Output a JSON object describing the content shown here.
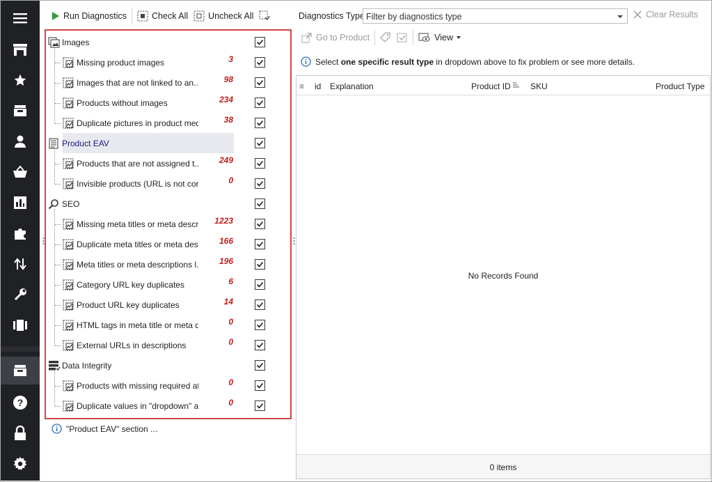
{
  "toolbar": {
    "run_label": "Run Diagnostics",
    "check_all_label": "Check All",
    "uncheck_all_label": "Uncheck All"
  },
  "sidebar": {
    "items": [
      "menu-icon",
      "store-icon",
      "star-icon",
      "inbox-icon",
      "user-icon",
      "basket-icon",
      "chart-icon",
      "puzzle-icon",
      "transfer-icon",
      "wrench-icon",
      "carousel-icon",
      "diagnostics-icon",
      "help-icon",
      "lock-icon",
      "gear-icon"
    ]
  },
  "tree": [
    {
      "type": "group",
      "label": "Images",
      "icon": "images-icon",
      "checked": true
    },
    {
      "type": "item",
      "label": "Missing product images",
      "count": "3",
      "icon": "image-warning-icon",
      "checked": true
    },
    {
      "type": "item",
      "label": "Images that are not linked to an...",
      "count": "98",
      "icon": "image-unlinked-icon",
      "checked": true
    },
    {
      "type": "item",
      "label": "Products without images",
      "count": "234",
      "icon": "image-missing-icon",
      "checked": true
    },
    {
      "type": "item",
      "label": "Duplicate pictures in product med...",
      "count": "38",
      "icon": "image-duplicate-icon",
      "checked": true
    },
    {
      "type": "group",
      "label": "Product  EAV",
      "icon": "eav-icon",
      "checked": true,
      "selected": true
    },
    {
      "type": "item",
      "label": "Products that are not assigned t...",
      "count": "249",
      "icon": "product-unassigned-icon",
      "checked": true
    },
    {
      "type": "item",
      "label": "Invisible products (URL is not cor...",
      "count": "0",
      "icon": "invisible-icon",
      "checked": true
    },
    {
      "type": "group",
      "label": "SEO",
      "icon": "search-icon",
      "checked": true
    },
    {
      "type": "item",
      "label": "Missing meta titles or meta descri...",
      "count": "1223",
      "icon": "meta-missing-icon",
      "checked": true
    },
    {
      "type": "item",
      "label": "Duplicate meta titles or meta des...",
      "count": "166",
      "icon": "meta-duplicate-icon",
      "checked": true
    },
    {
      "type": "item",
      "label": "Meta titles or meta descriptions l...",
      "count": "196",
      "icon": "meta-length-icon",
      "checked": true
    },
    {
      "type": "item",
      "label": "Category URL key duplicates",
      "count": "6",
      "icon": "category-url-icon",
      "checked": true
    },
    {
      "type": "item",
      "label": "Product URL key duplicates",
      "count": "14",
      "icon": "product-url-icon",
      "checked": true
    },
    {
      "type": "item",
      "label": "HTML tags in meta title or meta d...",
      "count": "0",
      "icon": "html-tags-icon",
      "checked": true
    },
    {
      "type": "item",
      "label": "External URLs in descriptions",
      "count": "0",
      "icon": "external-url-icon",
      "checked": true
    },
    {
      "type": "group",
      "label": "Data Integrity",
      "icon": "data-integrity-icon",
      "checked": true
    },
    {
      "type": "item",
      "label": "Products with missing required at...",
      "count": "0",
      "icon": "required-attr-icon",
      "checked": true
    },
    {
      "type": "item",
      "label": "Duplicate values in \"dropdown\" a...",
      "count": "0",
      "icon": "dropdown-dup-icon",
      "checked": true
    }
  ],
  "footer_note": "\"Product  EAV\" section ...",
  "right": {
    "type_label": "Diagnostics Type",
    "combo_placeholder": "Filter by diagnostics type",
    "clear_label": "Clear Results",
    "goto_label": "Go to Product",
    "view_label": "View",
    "info_pre": "Select ",
    "info_bold": "one specific result type",
    "info_post": " in dropdown above to fix problem or see more details.",
    "columns": [
      "id",
      "Explanation",
      "Product ID",
      "SKU",
      "Product Type"
    ],
    "empty_text": "No Records Found",
    "items_count": "0 items"
  },
  "colors": {
    "sidebar": "#1f2125",
    "highlight_border": "#d24545",
    "count_red": "#c21c1c",
    "accent_green": "#3a9a3a",
    "info_blue": "#2f6fb8"
  }
}
